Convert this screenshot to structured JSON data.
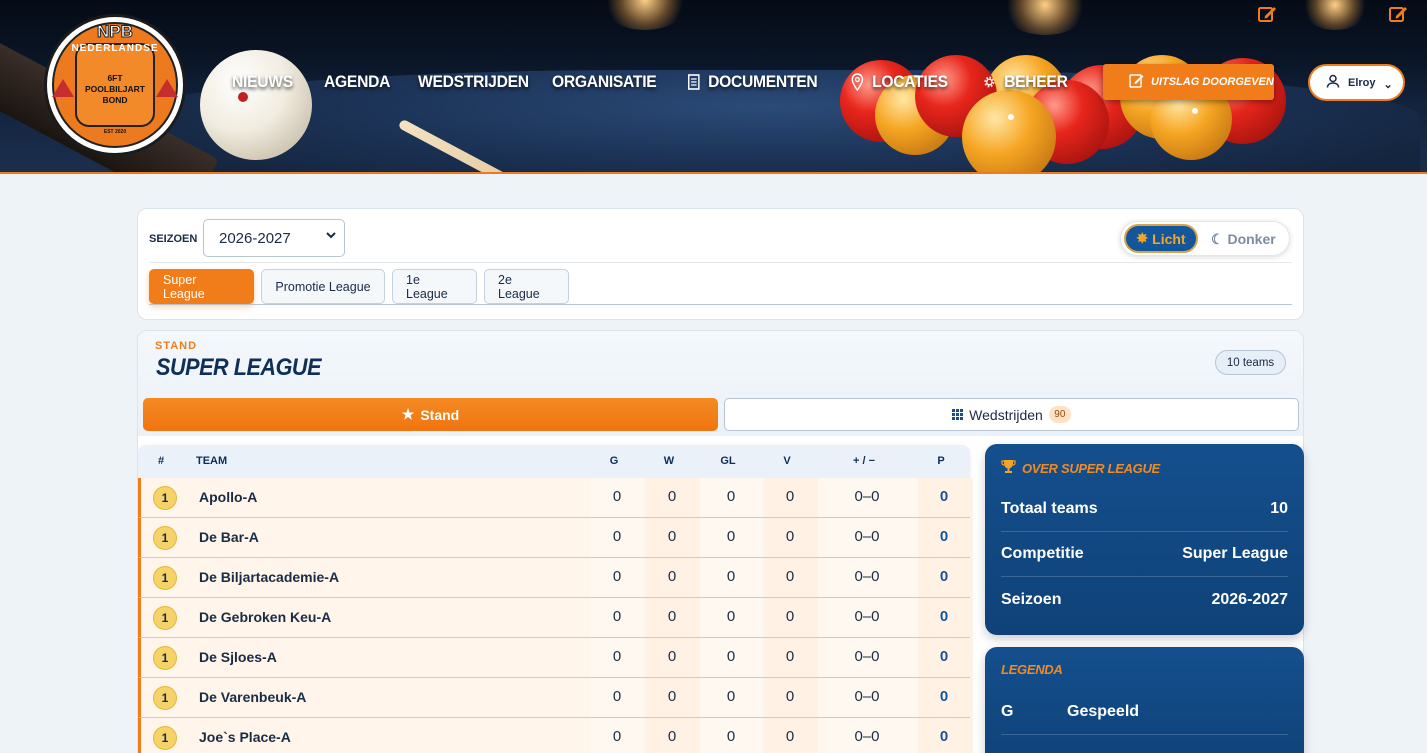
{
  "header": {
    "logo": {
      "top": "NPB",
      "ring": "NEDERLANDSE",
      "middle": "6FT POOLBILJART BOND",
      "est": "EST 2020"
    },
    "nav": [
      {
        "label": "NIEUWS",
        "icon": ""
      },
      {
        "label": "AGENDA",
        "icon": ""
      },
      {
        "label": "WEDSTRIJDEN",
        "icon": ""
      },
      {
        "label": "ORGANISATIE",
        "icon": ""
      },
      {
        "label": "DOCUMENTEN",
        "icon": "document-icon"
      },
      {
        "label": "LOCATIES",
        "icon": "location-pin-icon"
      },
      {
        "label": "BEHEER",
        "icon": "gear-icon"
      }
    ],
    "uitslag_button": "UITSLAG DOORGEVEN",
    "user": "Elroy"
  },
  "filters": {
    "seizoen_label": "SEIZOEN",
    "seizoen_value": "2026-2027",
    "theme_light": "Licht",
    "theme_dark": "Donker",
    "league_tabs": [
      "Super League",
      "Promotie League",
      "1e League",
      "2e League"
    ],
    "active_tab": 0
  },
  "stand": {
    "kicker": "STAND",
    "title": "SUPER LEAGUE",
    "teams_badge": "10 teams",
    "subtab_stand": "Stand",
    "subtab_wedstrijden": "Wedstrijden",
    "wedstrijden_count": "90",
    "columns": [
      "#",
      "TEAM",
      "G",
      "W",
      "GL",
      "V",
      "+ / −",
      "P"
    ],
    "rows": [
      {
        "rank": "1",
        "team": "Apollo-A",
        "g": "0",
        "w": "0",
        "gl": "0",
        "v": "0",
        "diff": "0–0",
        "p": "0"
      },
      {
        "rank": "1",
        "team": "De Bar-A",
        "g": "0",
        "w": "0",
        "gl": "0",
        "v": "0",
        "diff": "0–0",
        "p": "0"
      },
      {
        "rank": "1",
        "team": "De Biljartacademie-A",
        "g": "0",
        "w": "0",
        "gl": "0",
        "v": "0",
        "diff": "0–0",
        "p": "0"
      },
      {
        "rank": "1",
        "team": "De Gebroken Keu-A",
        "g": "0",
        "w": "0",
        "gl": "0",
        "v": "0",
        "diff": "0–0",
        "p": "0"
      },
      {
        "rank": "1",
        "team": "De Sjloes-A",
        "g": "0",
        "w": "0",
        "gl": "0",
        "v": "0",
        "diff": "0–0",
        "p": "0"
      },
      {
        "rank": "1",
        "team": "De Varenbeuk-A",
        "g": "0",
        "w": "0",
        "gl": "0",
        "v": "0",
        "diff": "0–0",
        "p": "0"
      },
      {
        "rank": "1",
        "team": "Joe`s Place-A",
        "g": "0",
        "w": "0",
        "gl": "0",
        "v": "0",
        "diff": "0–0",
        "p": "0"
      }
    ]
  },
  "about": {
    "title": "OVER SUPER LEAGUE",
    "rows": [
      {
        "label": "Totaal teams",
        "value": "10"
      },
      {
        "label": "Competitie",
        "value": "Super League"
      },
      {
        "label": "Seizoen",
        "value": "2026-2027"
      }
    ]
  },
  "legend": {
    "title": "LEGENDA",
    "rows": [
      {
        "key": "G",
        "value": "Gespeeld"
      }
    ]
  },
  "colors": {
    "accent": "#f07c1a",
    "navy": "#0f4278",
    "text": "#1a2b45"
  }
}
